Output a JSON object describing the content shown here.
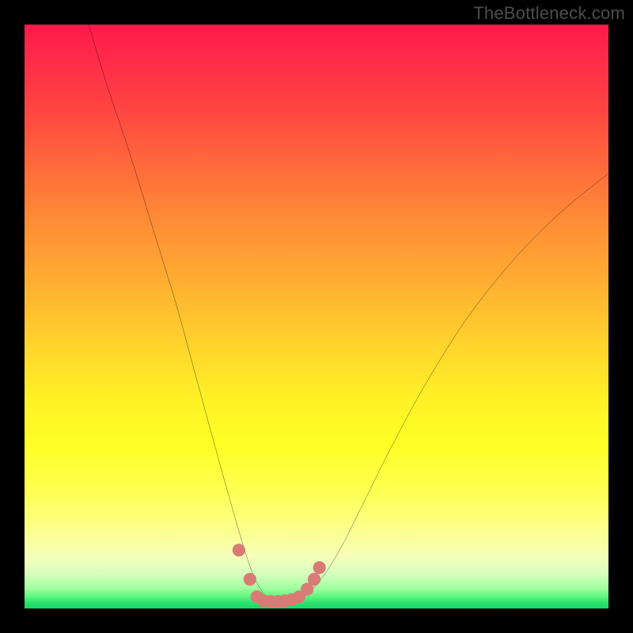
{
  "watermark": "TheBottleneck.com",
  "chart_data": {
    "type": "line",
    "title": "",
    "xlabel": "",
    "ylabel": "",
    "xlim": [
      0,
      100
    ],
    "ylim": [
      0,
      100
    ],
    "gradient_colors": {
      "top": "#ff1a4b",
      "mid_upper": "#ff8a36",
      "mid": "#ffff25",
      "mid_lower": "#a2ff9f",
      "bottom": "#19d765"
    },
    "series": [
      {
        "name": "bottleneck-curve",
        "color": "#000000",
        "x": [
          11,
          14,
          18,
          22,
          26,
          29,
          32,
          34.5,
          36.5,
          38,
          39.5,
          41,
          42.5,
          44,
          47,
          49,
          51.5,
          54.5,
          58,
          63,
          69,
          76,
          84,
          92,
          100
        ],
        "y": [
          100,
          90,
          78,
          65,
          52,
          41,
          30,
          21,
          14,
          9,
          5,
          2.5,
          1.5,
          1.5,
          1.8,
          3,
          6,
          11,
          18,
          28,
          39,
          50,
          60,
          68,
          74.5
        ]
      }
    ],
    "markers": {
      "name": "optimal-range-dots",
      "color": "#d87b75",
      "radius": 1.1,
      "x": [
        36.7,
        38.6,
        39.8,
        41.0,
        42.2,
        43.4,
        44.6,
        45.8,
        47.0,
        48.4,
        49.6,
        50.5
      ],
      "y": [
        10.0,
        5.0,
        2.0,
        1.3,
        1.2,
        1.2,
        1.3,
        1.5,
        2.0,
        3.3,
        5.0,
        7.0
      ]
    }
  }
}
